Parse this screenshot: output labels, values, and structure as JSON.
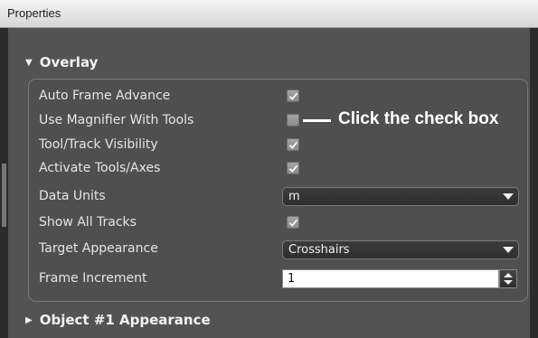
{
  "window": {
    "title": "Properties"
  },
  "sections": {
    "overlay": {
      "label": "Overlay",
      "expanded": true
    },
    "object_appearance": {
      "label": "Object #1 Appearance",
      "expanded": false
    }
  },
  "rows": {
    "auto_frame_advance": {
      "label": "Auto Frame Advance",
      "checked": true
    },
    "use_magnifier": {
      "label": "Use Magnifier With Tools",
      "checked": false
    },
    "tool_track_visibility": {
      "label": "Tool/Track Visibility",
      "checked": true
    },
    "activate_tools_axes": {
      "label": "Activate Tools/Axes",
      "checked": true
    },
    "data_units": {
      "label": "Data Units",
      "value": "m"
    },
    "show_all_tracks": {
      "label": "Show All Tracks",
      "checked": true
    },
    "target_appearance": {
      "label": "Target Appearance",
      "value": "Crosshairs"
    },
    "frame_increment": {
      "label": "Frame Increment",
      "value": "1"
    }
  },
  "annotation": {
    "text": "Click the check box"
  },
  "colors": {
    "panel_bg": "#535353",
    "title_bar": "#e3e3e3",
    "text": "#e6e6e6",
    "callout": "#ffffff"
  }
}
